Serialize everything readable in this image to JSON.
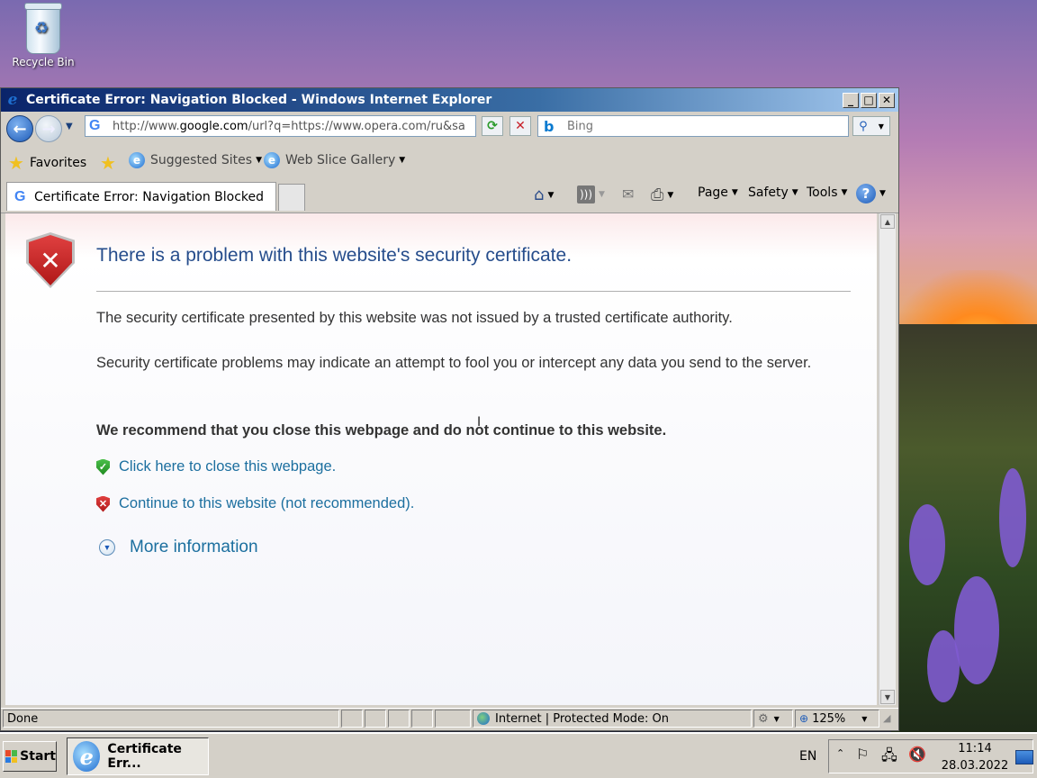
{
  "desktop": {
    "recycle_bin_label": "Recycle Bin"
  },
  "window": {
    "title": "Certificate Error: Navigation Blocked - Windows Internet Explorer",
    "minimize": "_",
    "maximize": "□",
    "close": "✕"
  },
  "address_bar": {
    "url_prefix": "http://www.",
    "url_domain": "google.com",
    "url_rest": "/url?q=https://www.opera.com/ru&sa",
    "search_placeholder": "Bing"
  },
  "favorites_bar": {
    "favorites_label": "Favorites",
    "suggested_sites": "Suggested Sites",
    "web_slice_gallery": "Web Slice Gallery"
  },
  "tabs": {
    "active_tab": "Certificate Error: Navigation Blocked"
  },
  "command_bar": {
    "page": "Page",
    "safety": "Safety",
    "tools": "Tools"
  },
  "content": {
    "heading": "There is a problem with this website's security certificate.",
    "para1": "The security certificate presented by this website was not issued by a trusted certificate authority.",
    "para2": "Security certificate problems may indicate an attempt to fool you or intercept any data you send to the server.",
    "recommend": "We recommend that you close this webpage and do not continue to this website.",
    "close_link": "Click here to close this webpage.",
    "continue_link": "Continue to this website (not recommended).",
    "more_info": "More information"
  },
  "status_bar": {
    "status": "Done",
    "zone": "Internet | Protected Mode: On",
    "zoom": "125%"
  },
  "taskbar": {
    "start": "Start",
    "task_label": "Certificate Err...",
    "language": "EN",
    "time": "11:14",
    "date": "28.03.2022"
  },
  "colors": {
    "heading_blue": "#264d8c",
    "link_blue": "#1c6f9f",
    "titlebar_start": "#0a246a"
  }
}
